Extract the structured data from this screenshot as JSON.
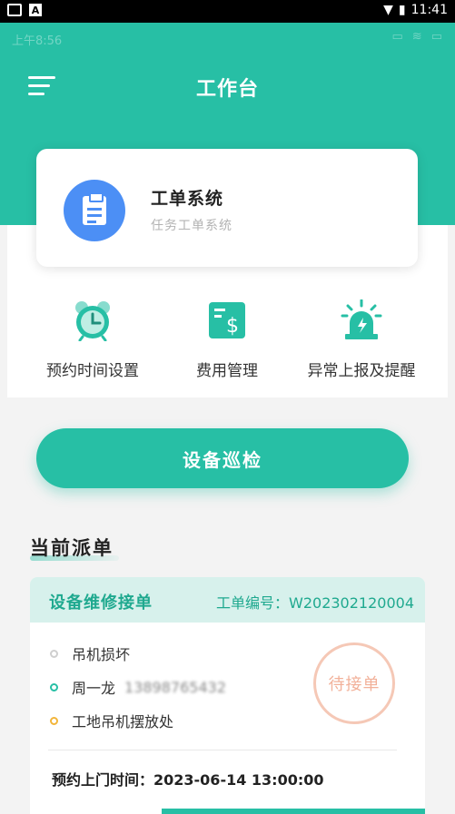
{
  "system_bar": {
    "time": "11:41"
  },
  "app_status": {
    "time": "上午8:56"
  },
  "header": {
    "title": "工作台"
  },
  "work_order_card": {
    "title": "工单系统",
    "subtitle": "任务工单系统"
  },
  "quick_actions": [
    {
      "label": "预约时间设置",
      "icon": "alarm-clock-icon"
    },
    {
      "label": "费用管理",
      "icon": "bill-icon"
    },
    {
      "label": "异常上报及提醒",
      "icon": "alarm-light-icon"
    }
  ],
  "inspect_button": {
    "label": "设备巡检"
  },
  "current_dispatch": {
    "title": "当前派单",
    "order": {
      "type": "设备维修接单",
      "number": "工单编号：W202302120004",
      "rows": [
        "吊机损坏",
        "周一龙",
        "工地吊机摆放处"
      ],
      "phone": "13898765432",
      "status": "待接单",
      "appointment": "预约上门时间：2023-06-14 13:00:00"
    }
  },
  "colors": {
    "primary": "#27bfa5",
    "blue": "#4c8ff5",
    "stamp": "#f2b19a"
  }
}
